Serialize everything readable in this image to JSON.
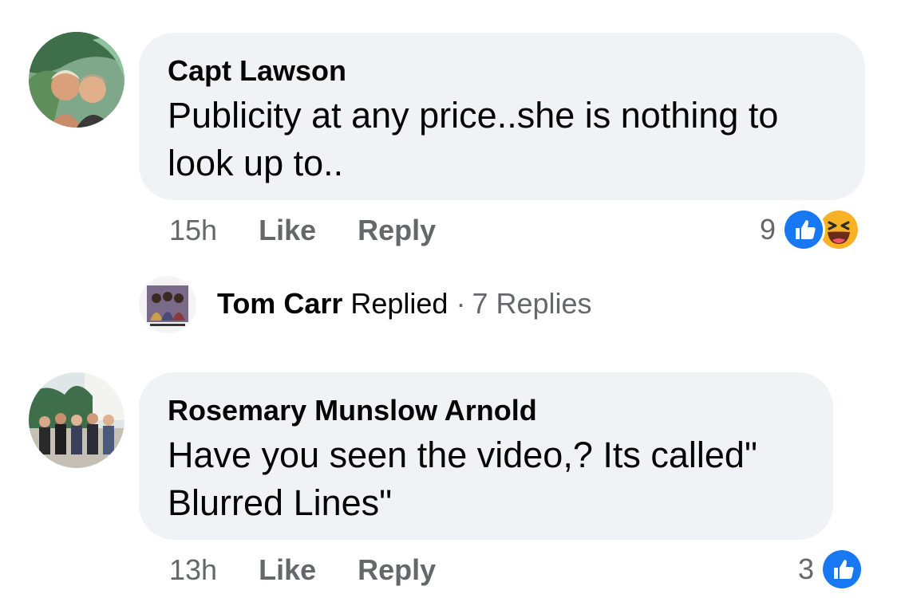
{
  "comments": [
    {
      "author": "Capt Lawson",
      "text": "Publicity at any price..she is nothing to look up to..",
      "time": "15h",
      "like_label": "Like",
      "reply_label": "Reply",
      "reaction_count": "9",
      "reactions": [
        "like-icon",
        "haha-icon"
      ],
      "thread": {
        "name": "Tom Carr",
        "verb": "Replied",
        "separator": "·",
        "count": "7 Replies"
      }
    },
    {
      "author": "Rosemary Munslow Arnold",
      "text": "Have you seen the video,? Its called\" Blurred Lines\"",
      "time": "13h",
      "like_label": "Like",
      "reply_label": "Reply",
      "reaction_count": "3",
      "reactions": [
        "like-icon"
      ]
    }
  ],
  "colors": {
    "bubble": "#f0f2f5",
    "meta_text": "#65676b",
    "like_blue": "#1877f2",
    "haha_yellow": "#f7b125"
  }
}
